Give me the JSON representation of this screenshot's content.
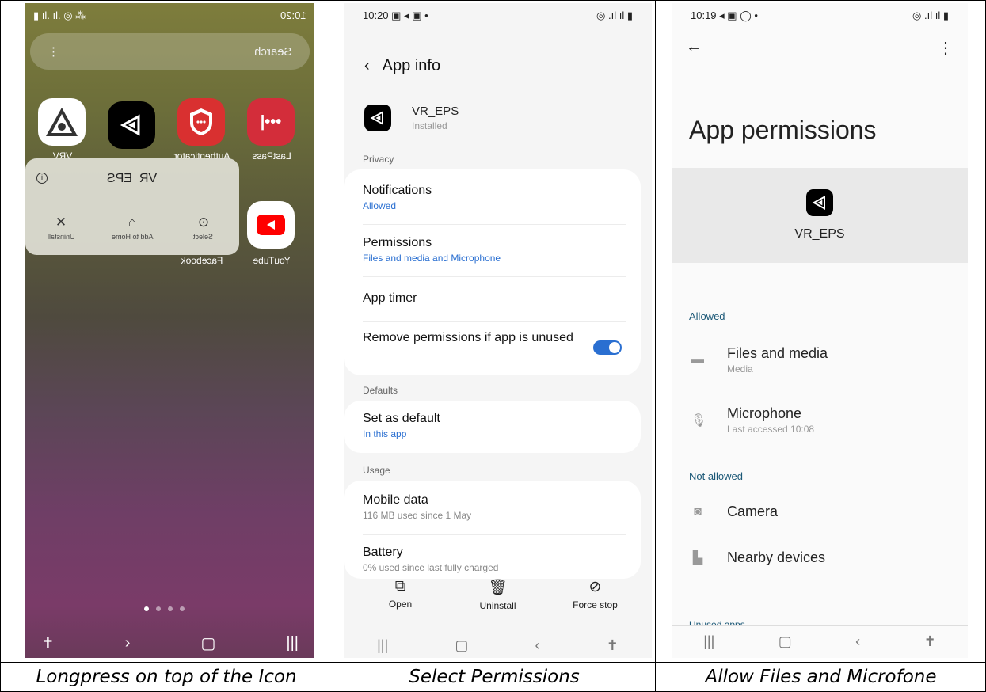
{
  "captions": [
    "Longpress on top of the Icon",
    "Select Permissions",
    "Allow Files and Microfone"
  ],
  "panel1": {
    "status_time": "10:20",
    "search_placeholder": "Search",
    "apps_row1": [
      "LastPass",
      "Authenticator",
      "",
      "VRV"
    ],
    "apps_row2": [
      "YouTube",
      "Facebook"
    ],
    "popup_title": "VR_EPS",
    "popup_actions": [
      "Select",
      "Add to Home",
      "Uninstall"
    ],
    "page_dots": 4
  },
  "panel2": {
    "status_time": "10:20",
    "title": "App info",
    "app_name": "VR_EPS",
    "app_status": "Installed",
    "sections": {
      "privacy": "Privacy",
      "defaults": "Defaults",
      "usage": "Usage"
    },
    "notifications": {
      "title": "Notifications",
      "sub": "Allowed"
    },
    "permissions": {
      "title": "Permissions",
      "sub": "Files and media and Microphone"
    },
    "app_timer": "App timer",
    "remove_permissions": "Remove permissions if app is unused",
    "set_default": {
      "title": "Set as default",
      "sub": "In this app"
    },
    "mobile_data": {
      "title": "Mobile data",
      "sub": "116 MB used since 1 May"
    },
    "battery": {
      "title": "Battery",
      "sub": "0% used since last fully charged"
    },
    "bottom_actions": [
      "Open",
      "Uninstall",
      "Force stop"
    ]
  },
  "panel3": {
    "status_time": "10:19",
    "title": "App permissions",
    "app_name": "VR_EPS",
    "allowed_label": "Allowed",
    "files": {
      "title": "Files and media",
      "sub": "Media"
    },
    "microphone": {
      "title": "Microphone",
      "sub": "Last accessed 10:08"
    },
    "not_allowed_label": "Not allowed",
    "camera": "Camera",
    "nearby": "Nearby devices",
    "unused_apps": "Unused apps"
  },
  "colors": {
    "accent_blue": "#2a6fd1",
    "group_teal": "#1b5877"
  }
}
